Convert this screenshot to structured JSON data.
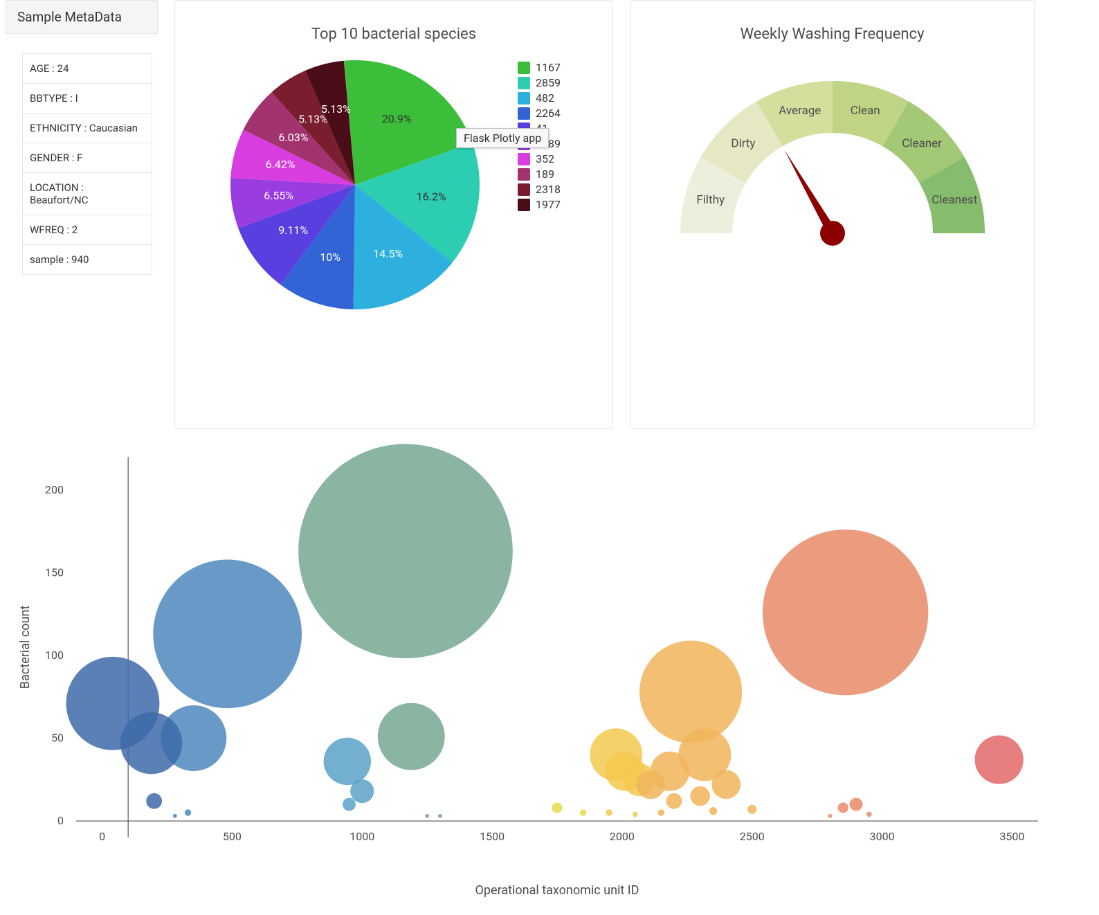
{
  "sidebar": {
    "header": "Sample MetaData",
    "items": [
      {
        "label": "AGE : 24"
      },
      {
        "label": "BBTYPE : I"
      },
      {
        "label": "ETHNICITY : Caucasian"
      },
      {
        "label": "GENDER : F"
      },
      {
        "label": "LOCATION : Beaufort/NC"
      },
      {
        "label": "WFREQ : 2"
      },
      {
        "label": "sample : 940"
      }
    ]
  },
  "tooltip_text": "Flask Plotly app",
  "chart_data": [
    {
      "type": "pie",
      "title": "Top 10 bacterial species",
      "slices": [
        {
          "id": "1167",
          "pct": 20.9,
          "color": "#3bbf3b",
          "label": "20.9%",
          "label_color": "#333"
        },
        {
          "id": "2859",
          "pct": 16.2,
          "color": "#2dcdb1",
          "label": "16.2%",
          "label_color": "#333"
        },
        {
          "id": "482",
          "pct": 14.5,
          "color": "#2db0dd",
          "label": "14.5%",
          "label_color": "#fff"
        },
        {
          "id": "2264",
          "pct": 10.0,
          "color": "#3264d6",
          "label": "10%",
          "label_color": "#fff"
        },
        {
          "id": "41",
          "pct": 9.11,
          "color": "#5a3fe0",
          "label": "9.11%",
          "label_color": "#fff"
        },
        {
          "id": "1189",
          "pct": 6.55,
          "color": "#9a3de0",
          "label": "6.55%",
          "label_color": "#fff"
        },
        {
          "id": "352",
          "pct": 6.42,
          "color": "#d83de0",
          "label": "6.42%",
          "label_color": "#fff"
        },
        {
          "id": "189",
          "pct": 6.03,
          "color": "#a3336f",
          "label": "6.03%",
          "label_color": "#fff"
        },
        {
          "id": "2318",
          "pct": 5.13,
          "color": "#7a1d2e",
          "label": "5.13%",
          "label_color": "#fff"
        },
        {
          "id": "1977",
          "pct": 5.13,
          "color": "#4a0d17",
          "label": "5.13%",
          "label_color": "#fff"
        }
      ],
      "legend": [
        "1167",
        "2859",
        "482",
        "2264",
        "41",
        "1189",
        "352",
        "189",
        "2318",
        "1977"
      ]
    },
    {
      "type": "gauge",
      "title": "Weekly Washing Frequency",
      "value": 2,
      "min": 0,
      "max": 6,
      "bands": [
        {
          "label": "Filthy",
          "color": "#eeeedc"
        },
        {
          "label": "Dirty",
          "color": "#e5e8c2"
        },
        {
          "label": "Average",
          "color": "#d5df9d"
        },
        {
          "label": "Clean",
          "color": "#bfd484"
        },
        {
          "label": "Cleaner",
          "color": "#a3c876"
        },
        {
          "label": "Cleanest",
          "color": "#85bc6e"
        }
      ],
      "needle_color": "#8b0000"
    },
    {
      "type": "scatter",
      "bubble": true,
      "xlabel": "Operational taxonomic unit ID",
      "ylabel": "Bacterial count",
      "xlim": [
        -100,
        3600
      ],
      "ylim": [
        -10,
        220
      ],
      "xticks": [
        0,
        500,
        1000,
        1500,
        2000,
        2500,
        3000,
        3500
      ],
      "yticks": [
        0,
        50,
        100,
        150,
        200
      ],
      "points": [
        {
          "x": 1167,
          "y": 163,
          "size": 163,
          "color": "#74a892"
        },
        {
          "x": 2859,
          "y": 126,
          "size": 126,
          "color": "#e88b68"
        },
        {
          "x": 482,
          "y": 113,
          "size": 113,
          "color": "#4f88bd"
        },
        {
          "x": 2264,
          "y": 78,
          "size": 78,
          "color": "#f1b55a"
        },
        {
          "x": 41,
          "y": 71,
          "size": 71,
          "color": "#3d6aa9"
        },
        {
          "x": 1189,
          "y": 51,
          "size": 51,
          "color": "#74a892"
        },
        {
          "x": 352,
          "y": 50,
          "size": 50,
          "color": "#4f88bd"
        },
        {
          "x": 189,
          "y": 47,
          "size": 47,
          "color": "#3d6aa9"
        },
        {
          "x": 2318,
          "y": 40,
          "size": 40,
          "color": "#f1b55a"
        },
        {
          "x": 1977,
          "y": 40,
          "size": 40,
          "color": "#f3c94f"
        },
        {
          "x": 3450,
          "y": 37,
          "size": 37,
          "color": "#e36868"
        },
        {
          "x": 943,
          "y": 36,
          "size": 36,
          "color": "#5aa2c8"
        },
        {
          "x": 2184,
          "y": 30,
          "size": 30,
          "color": "#f1b55a"
        },
        {
          "x": 2011,
          "y": 30,
          "size": 30,
          "color": "#f3c94f"
        },
        {
          "x": 2065,
          "y": 25,
          "size": 25,
          "color": "#f3c94f"
        },
        {
          "x": 2110,
          "y": 22,
          "size": 22,
          "color": "#f1b55a"
        },
        {
          "x": 2400,
          "y": 22,
          "size": 22,
          "color": "#f1b55a"
        },
        {
          "x": 1000,
          "y": 18,
          "size": 18,
          "color": "#5aa2c8"
        },
        {
          "x": 2300,
          "y": 15,
          "size": 15,
          "color": "#f1b55a"
        },
        {
          "x": 2200,
          "y": 12,
          "size": 12,
          "color": "#f1b55a"
        },
        {
          "x": 200,
          "y": 12,
          "size": 12,
          "color": "#3d6aa9"
        },
        {
          "x": 2900,
          "y": 10,
          "size": 10,
          "color": "#e88b68"
        },
        {
          "x": 2850,
          "y": 8,
          "size": 8,
          "color": "#e88b68"
        },
        {
          "x": 950,
          "y": 10,
          "size": 10,
          "color": "#5aa2c8"
        },
        {
          "x": 1950,
          "y": 5,
          "size": 5,
          "color": "#f3c94f"
        },
        {
          "x": 1850,
          "y": 5,
          "size": 5,
          "color": "#e8d94f"
        },
        {
          "x": 1750,
          "y": 8,
          "size": 8,
          "color": "#e8d94f"
        },
        {
          "x": 2500,
          "y": 7,
          "size": 7,
          "color": "#f1b55a"
        },
        {
          "x": 2350,
          "y": 6,
          "size": 6,
          "color": "#f1b55a"
        },
        {
          "x": 2150,
          "y": 5,
          "size": 5,
          "color": "#f1b55a"
        },
        {
          "x": 2050,
          "y": 4,
          "size": 4,
          "color": "#f3c94f"
        },
        {
          "x": 330,
          "y": 5,
          "size": 5,
          "color": "#4f88bd"
        },
        {
          "x": 280,
          "y": 3,
          "size": 3,
          "color": "#4f88bd"
        },
        {
          "x": 1250,
          "y": 3,
          "size": 3,
          "color": "#74a892"
        },
        {
          "x": 1300,
          "y": 3,
          "size": 3,
          "color": "#74a892"
        },
        {
          "x": 2800,
          "y": 3,
          "size": 3,
          "color": "#e88b68"
        },
        {
          "x": 2950,
          "y": 4,
          "size": 4,
          "color": "#e88b68"
        }
      ]
    }
  ]
}
